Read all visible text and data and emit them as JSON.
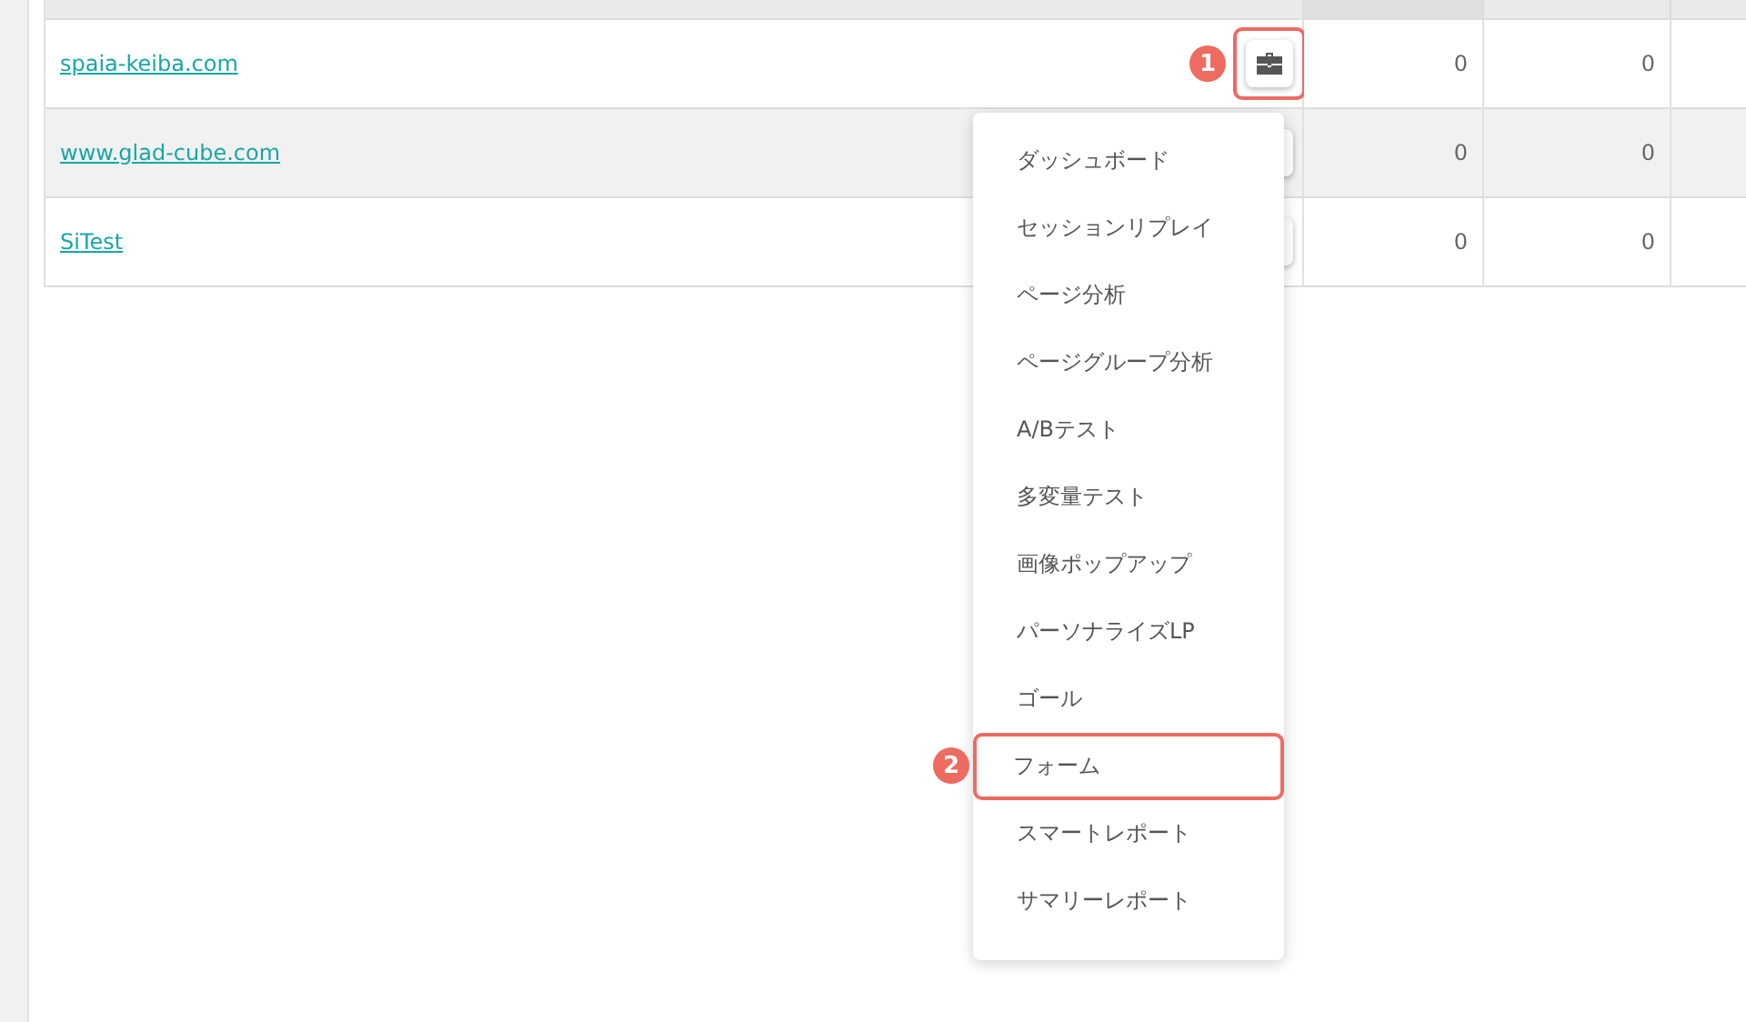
{
  "table": {
    "rows": [
      {
        "site": "spaia-keiba.com",
        "values": [
          "0",
          "0"
        ],
        "callout": "1"
      },
      {
        "site": "www.glad-cube.com",
        "values": [
          "0",
          "0"
        ]
      },
      {
        "site": "SiTest",
        "values": [
          "0",
          "0"
        ]
      }
    ]
  },
  "menu": {
    "items": [
      {
        "label": "ダッシュボード",
        "highlighted": false
      },
      {
        "label": "セッションリプレイ",
        "highlighted": false
      },
      {
        "label": "ページ分析",
        "highlighted": false
      },
      {
        "label": "ページグループ分析",
        "highlighted": false
      },
      {
        "label": "A/Bテスト",
        "highlighted": false
      },
      {
        "label": "多変量テスト",
        "highlighted": false
      },
      {
        "label": "画像ポップアップ",
        "highlighted": false
      },
      {
        "label": "パーソナライズLP",
        "highlighted": false
      },
      {
        "label": "ゴール",
        "highlighted": false
      },
      {
        "label": "フォーム",
        "highlighted": true,
        "callout": "2"
      },
      {
        "label": "スマートレポート",
        "highlighted": false
      },
      {
        "label": "サマリーレポート",
        "highlighted": false
      }
    ]
  }
}
